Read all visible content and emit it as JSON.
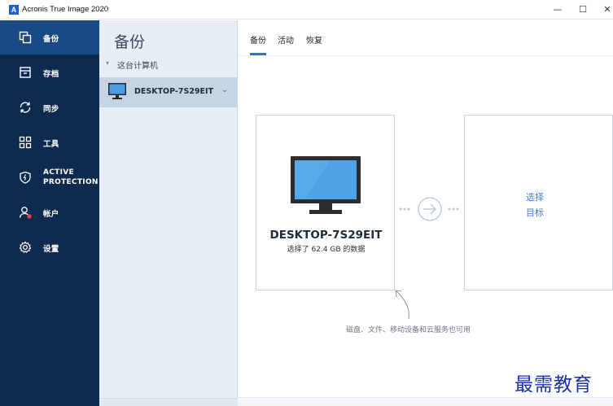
{
  "window": {
    "title": "Acronis True Image 2020",
    "icon_letter": "A",
    "minimize": "—",
    "maximize": "☐",
    "close": "✕"
  },
  "sidebar": {
    "items": [
      {
        "label": "备份",
        "icon": "backup-icon",
        "active": true
      },
      {
        "label": "存档",
        "icon": "archive-icon",
        "active": false
      },
      {
        "label": "同步",
        "icon": "sync-icon",
        "active": false
      },
      {
        "label": "工具",
        "icon": "tools-grid-icon",
        "active": false
      },
      {
        "label": "ACTIVE PROTECTION",
        "label_line1": "ACTIVE",
        "label_line2": "PROTECTION",
        "icon": "shield-icon",
        "active": false
      },
      {
        "label": "帐户",
        "icon": "account-icon",
        "active": false
      },
      {
        "label": "设置",
        "icon": "gear-icon",
        "active": false
      }
    ]
  },
  "backup_list": {
    "title": "备份",
    "group_label": "这台计算机",
    "group_caret": "▾",
    "items": [
      {
        "label": "DESKTOP-7S29EIT",
        "chevron": "⌄"
      }
    ]
  },
  "main": {
    "tabs": [
      {
        "label": "备份",
        "active": true
      },
      {
        "label": "活动",
        "active": false
      },
      {
        "label": "恢复",
        "active": false
      }
    ],
    "source": {
      "name": "DESKTOP-7S29EIT",
      "subtitle": "选择了 62.4 GB 的数据"
    },
    "destination": {
      "line1": "选择",
      "line2": "目标"
    },
    "hint": "磁盘、文件、移动设备和云服务也可用"
  },
  "colors": {
    "nav_bg": "#0e2a4e",
    "nav_active": "#1a4a86",
    "accent": "#2f73c9",
    "panel_bg": "#e8eef5",
    "selected_row": "#c6d5e6"
  },
  "watermark": "最需教育"
}
